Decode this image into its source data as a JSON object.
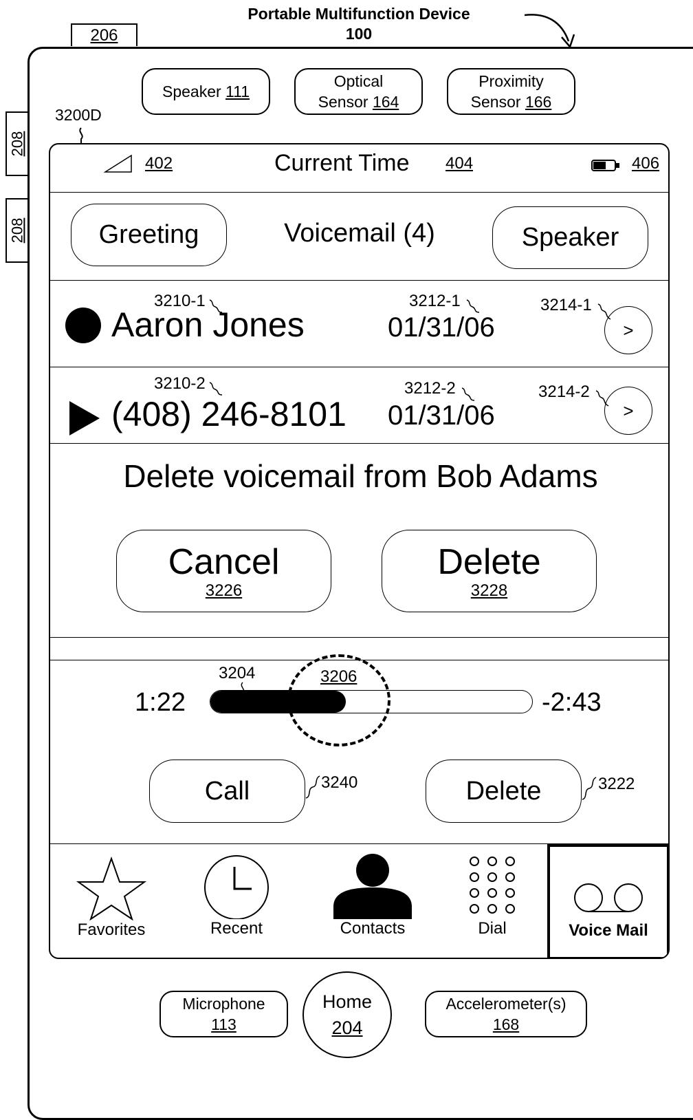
{
  "figure": {
    "title_line1": "Portable Multifunction Device",
    "title_line2": "100",
    "ref_206": "206",
    "ref_208a": "208",
    "ref_208b": "208",
    "ref_3200d": "3200D"
  },
  "hardware_top": [
    {
      "name": "Speaker",
      "ref": "111"
    },
    {
      "name": "Optical",
      "name2": "Sensor",
      "ref": "164"
    },
    {
      "name": "Proximity",
      "name2": "Sensor",
      "ref": "166"
    }
  ],
  "hardware_bottom": [
    {
      "name": "Microphone",
      "ref": "113"
    },
    {
      "name": "Home",
      "ref": "204"
    },
    {
      "name": "Accelerometer(s)",
      "ref": "168"
    }
  ],
  "status_bar": {
    "signal_ref": "402",
    "time": "Current Time",
    "time_ref": "404",
    "battery_ref": "406"
  },
  "header": {
    "greeting": "Greeting",
    "title": "Voicemail (4)",
    "speaker": "Speaker"
  },
  "voicemails": [
    {
      "name": "Aaron Jones",
      "date": "01/31/06",
      "name_ref": "3210-1",
      "date_ref": "3212-1",
      "btn_ref": "3214-1",
      "btn": ">",
      "status": "unheard"
    },
    {
      "name": "(408) 246-8101",
      "date": "01/31/06",
      "name_ref": "3210-2",
      "date_ref": "3212-2",
      "btn_ref": "3214-2",
      "btn": ">",
      "status": "playing"
    }
  ],
  "confirm": {
    "message": "Delete voicemail from Bob Adams",
    "cancel": "Cancel",
    "cancel_ref": "3226",
    "delete": "Delete",
    "delete_ref": "3228"
  },
  "playback": {
    "elapsed": "1:22",
    "remaining": "-2:43",
    "bar_ref": "3204",
    "thumb_ref": "3206",
    "progress_fraction": 0.42,
    "call": "Call",
    "call_ref": "3240",
    "delete": "Delete",
    "delete_ref": "3222"
  },
  "tab_bar": [
    {
      "label": "Favorites",
      "icon": "star-icon"
    },
    {
      "label": "Recent",
      "icon": "clock-icon"
    },
    {
      "label": "Contacts",
      "icon": "person-icon"
    },
    {
      "label": "Dial",
      "icon": "keypad-icon"
    },
    {
      "label": "Voice Mail",
      "icon": "voicemail-icon",
      "selected": true
    }
  ]
}
